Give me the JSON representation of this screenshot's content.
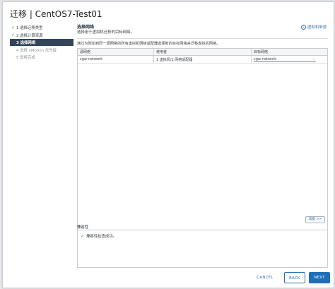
{
  "dialog": {
    "title": "迁移 | CentOS7-Test01"
  },
  "steps": [
    {
      "label": "1 选择迁移类型",
      "state": "done"
    },
    {
      "label": "2 选择计算资源",
      "state": "done"
    },
    {
      "label": "3 选择网络",
      "state": "active"
    },
    {
      "label": "4 选择 vMotion 优先级",
      "state": "disabled"
    },
    {
      "label": "5 即将完成",
      "state": "disabled"
    }
  ],
  "section": {
    "title": "选择网络",
    "subtitle": "选择用于虚拟机迁移的目标网络。",
    "help_link": "虚拟机来源"
  },
  "description": "通过为附加到同一源网络的所有虚拟机网络适配器选择新的目标网络来迁移虚拟机网络。",
  "table": {
    "headers": [
      "源网络",
      "使用者",
      "目标网络"
    ],
    "rows": [
      {
        "source": "cgw-network",
        "used_by": "1 虚拟机/1 网络适配器",
        "destination": "cgw-network"
      }
    ]
  },
  "collapse_label": "高级 >>",
  "compatibility": {
    "label": "兼容性",
    "message": "兼容性检查成功。"
  },
  "buttons": {
    "cancel": "CANCEL",
    "back": "BACK",
    "next": "NEXT"
  },
  "colors": {
    "accent": "#1f6fb8",
    "active_step_bg": "#334559",
    "success": "#2f8a3c"
  }
}
